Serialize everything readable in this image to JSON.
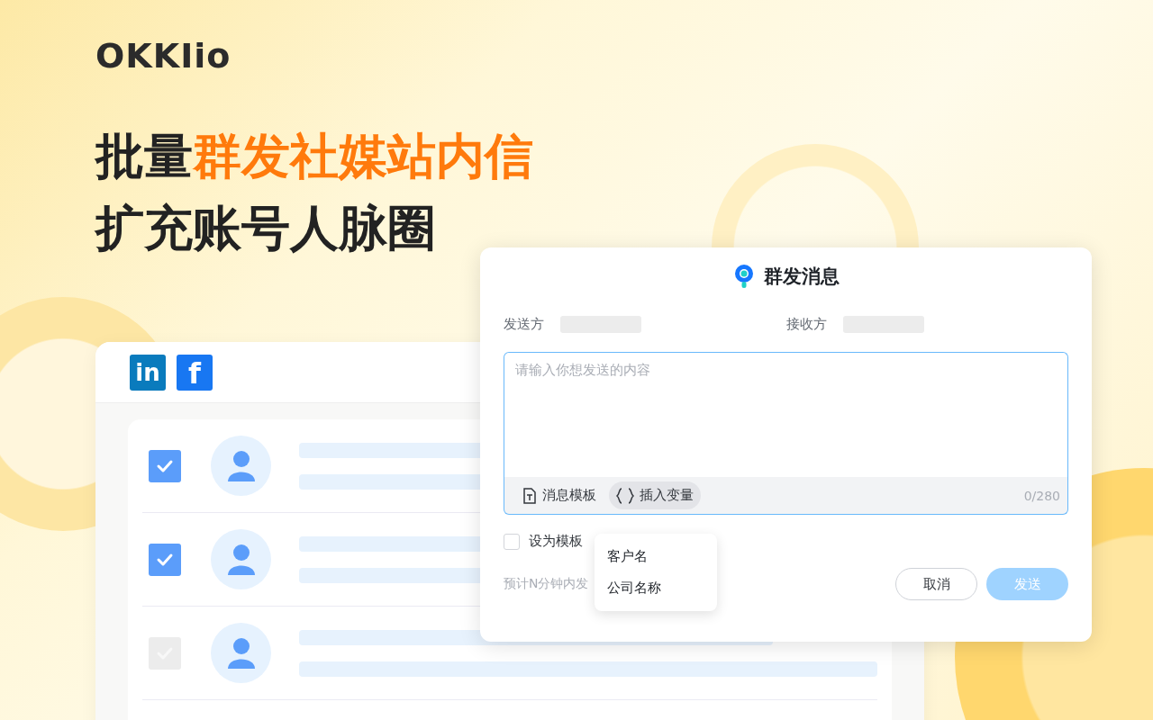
{
  "logo": "OKKIio",
  "headline": {
    "line1_plain": "批量",
    "line1_highlight": "群发社媒站内信",
    "line2": "扩充账号人脉圈"
  },
  "contacts_panel": {
    "social": [
      {
        "kind": "linkedin",
        "label": "in"
      },
      {
        "kind": "facebook",
        "label": "f"
      }
    ],
    "rows": [
      {
        "checked": true,
        "disabled": false
      },
      {
        "checked": true,
        "disabled": false
      },
      {
        "checked": true,
        "disabled": true
      }
    ]
  },
  "dialog": {
    "title": "群发消息",
    "sender_label": "发送方",
    "receiver_label": "接收方",
    "message": {
      "placeholder": "请输入你想发送的内容",
      "counter": "0/280"
    },
    "tools": [
      {
        "kind": "template",
        "label": "消息模板",
        "selected": false
      },
      {
        "kind": "variable",
        "label": "插入变量",
        "selected": true
      }
    ],
    "save_template": {
      "label": "设为模板",
      "checked": false
    },
    "note": "预计N分钟内发",
    "variable_menu": [
      "客户名",
      "公司名称"
    ],
    "cancel": "取消",
    "send": {
      "label": "发送",
      "disabled": true
    }
  }
}
